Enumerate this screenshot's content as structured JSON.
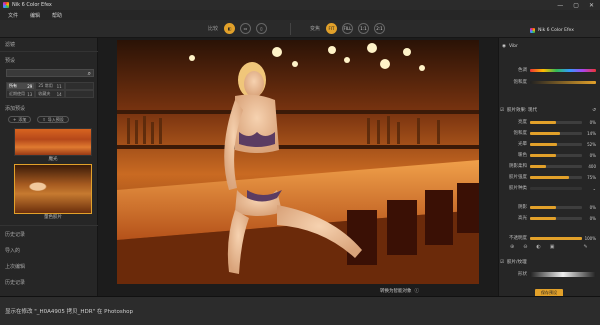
{
  "window": {
    "title": "Nik 6 Color Efex",
    "minimize": "—",
    "maximize": "▢",
    "close": "✕"
  },
  "menu": [
    "文件",
    "编辑",
    "帮助"
  ],
  "toolbar": {
    "compare_label": "比较",
    "zoom_label": "变焦",
    "zoom_fit": "FIT",
    "zoom_fill": "FILL",
    "zoom_1": "1:1",
    "zoom_2": "2:1"
  },
  "left_panel": {
    "section1": "滤镜",
    "section2": "预设",
    "categories": [
      {
        "label": "所有",
        "count": "29",
        "selected": true
      },
      {
        "label": "25 常用",
        "count": "11"
      },
      {
        "label": "近期使用",
        "count": "13"
      },
      {
        "label": "收藏夹",
        "count": "14"
      }
    ],
    "add_label": "添加预设",
    "pill_add": "添加",
    "pill_import": "导入预设",
    "thumbs": [
      {
        "label": "魔光"
      },
      {
        "label": "量色胶片",
        "selected": true
      }
    ],
    "bottom_items": [
      "历史记录",
      "导入的",
      "上次编辑",
      "历史记录"
    ]
  },
  "right_panel": {
    "app_title": "Nik 6 Color Efex",
    "layer_label": "Vibr",
    "color_label": "色调",
    "saturation_label": "饱和度",
    "filter_label": "胶片效果: 现代",
    "controls": [
      {
        "label": "亮度",
        "value": "0%",
        "fill": 0.5
      },
      {
        "label": "饱和度",
        "value": "14%",
        "fill": 0.57
      },
      {
        "label": "光晕",
        "value": "52%",
        "fill": 0.52
      },
      {
        "label": "暖色",
        "value": "0%",
        "fill": 0.5
      },
      {
        "label": "阴影柔和",
        "value": "400",
        "fill": 0.3
      },
      {
        "label": "胶片强度",
        "value": "75%",
        "fill": 0.75
      },
      {
        "label": "胶片种类",
        "value": "",
        "fill": 0.0
      },
      {
        "label": "阴影",
        "value": "0%",
        "fill": 0.5
      },
      {
        "label": "高光",
        "value": "0%",
        "fill": 0.5
      },
      {
        "label": "不透明度",
        "value": "100%",
        "fill": 1.0
      }
    ],
    "grain_label": "胶片/纹理",
    "shape_label": "形状",
    "save_button": "保存预设"
  },
  "viewer": {
    "status_text": "转换为智能对象"
  },
  "statusbar": {
    "text": "显示在修改 \"_H0A4905 拷贝_HDR\" 在 Photoshop"
  },
  "colors": {
    "accent": "#e2a12a",
    "bg": "#262626"
  }
}
